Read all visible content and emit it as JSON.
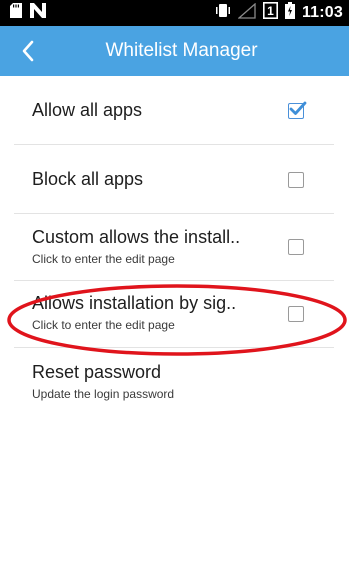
{
  "status_bar": {
    "time": "11:03",
    "sim_label": "1",
    "icons": [
      "sd-card-icon",
      "n-icon",
      "vibrate-icon",
      "no-signal-icon",
      "sim-icon",
      "battery-icon"
    ]
  },
  "app_bar": {
    "title": "Whitelist Manager",
    "back_icon": "chevron-left-icon",
    "background_color": "#4aa3e2"
  },
  "settings": {
    "items": [
      {
        "title": "Allow all apps",
        "subtitle": "",
        "checked": true
      },
      {
        "title": "Block all apps",
        "subtitle": "",
        "checked": false
      },
      {
        "title": "Custom allows the install..",
        "subtitle": "Click to enter the edit page",
        "checked": false
      },
      {
        "title": "Allows installation by sig..",
        "subtitle": "Click to enter the edit page",
        "checked": false
      },
      {
        "title": "Reset password",
        "subtitle": "Update the login password"
      }
    ]
  },
  "annotation": {
    "highlight_color": "#e0141c",
    "highlighted_item": "Allows installation by sig.."
  },
  "colors": {
    "accent": "#4a90d9",
    "divider": "#e3e3e3"
  }
}
